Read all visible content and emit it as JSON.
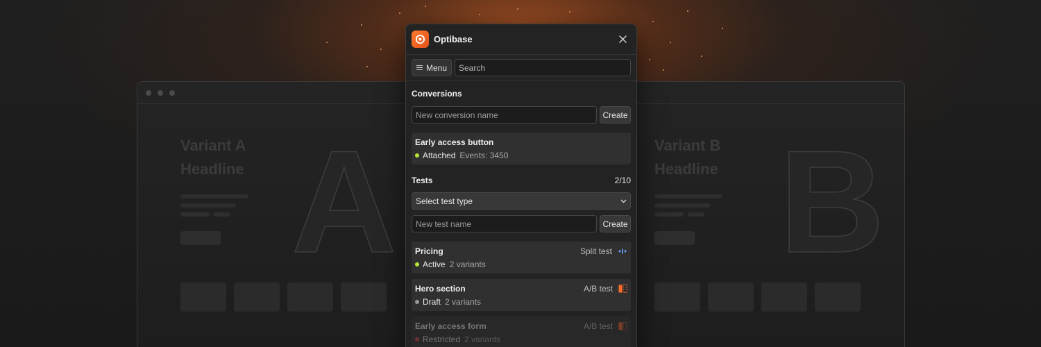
{
  "app": {
    "title": "Optibase",
    "close_icon": "close-icon",
    "logo_icon": "optibase-logo-icon"
  },
  "toolbar": {
    "menu_label": "Menu",
    "search_placeholder": "Search"
  },
  "conversions": {
    "heading": "Conversions",
    "input_placeholder": "New conversion name",
    "create_label": "Create",
    "items": [
      {
        "title": "Early access button",
        "status": "Attached",
        "status_color": "#b6e63a",
        "meta": "Events: 3450"
      }
    ]
  },
  "tests": {
    "heading": "Tests",
    "count": "2/10",
    "select_label": "Select test type",
    "input_placeholder": "New test name",
    "create_label": "Create",
    "items": [
      {
        "title": "Pricing",
        "type": "Split test",
        "icon": "split-test-icon",
        "status": "Active",
        "status_color": "#b6e63a",
        "meta": "2 variants"
      },
      {
        "title": "Hero section",
        "type": "A/B test",
        "icon": "ab-test-icon",
        "status": "Draft",
        "status_color": "#9a9a9a",
        "meta": "2 variants"
      },
      {
        "title": "Early access form",
        "type": "A/B test",
        "icon": "ab-test-icon",
        "status": "Restricted",
        "status_color": "#e5484d",
        "meta": "2 variants"
      }
    ]
  },
  "background": {
    "variant_a_title": "Variant A",
    "variant_a_sub": "Headline",
    "variant_a_letter": "A",
    "variant_b_title": "Variant B",
    "variant_b_sub": "Headline",
    "variant_b_letter": "B"
  },
  "colors": {
    "accent": "#ff6b2c",
    "panel": "#232323",
    "active": "#b6e63a",
    "restricted": "#e5484d"
  }
}
